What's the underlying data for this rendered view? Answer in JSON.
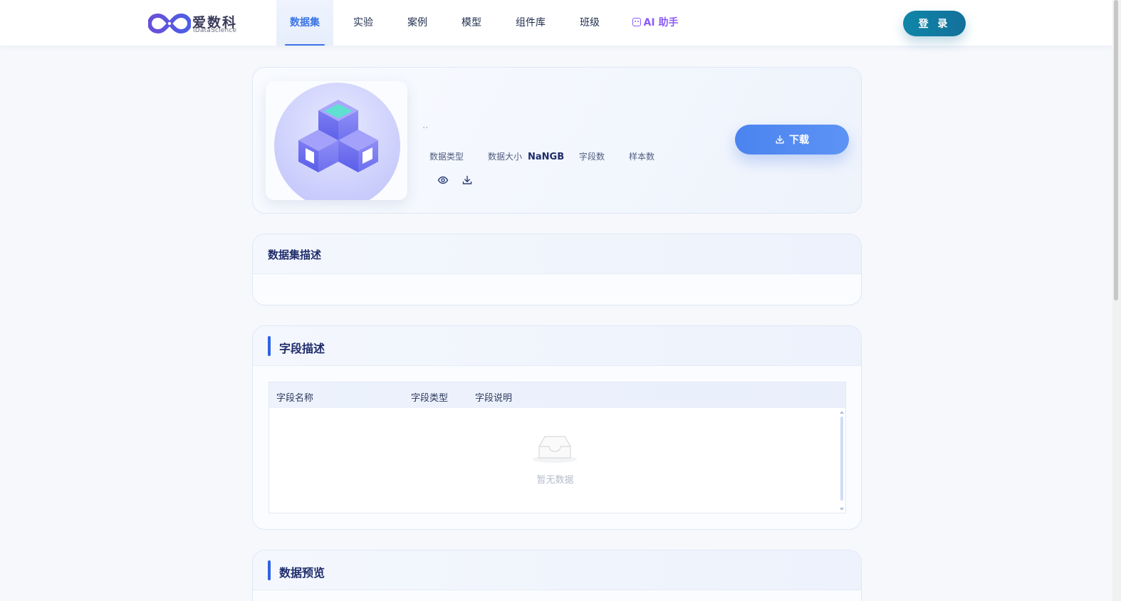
{
  "header": {
    "logo": {
      "cn": "爱数科",
      "en": "iDataScience"
    },
    "nav": [
      {
        "label": "数据集",
        "active": true
      },
      {
        "label": "实验",
        "active": false
      },
      {
        "label": "案例",
        "active": false
      },
      {
        "label": "模型",
        "active": false
      },
      {
        "label": "组件库",
        "active": false
      },
      {
        "label": "班级",
        "active": false
      },
      {
        "label": "AI 助手",
        "active": false
      }
    ],
    "login_label": "登 录"
  },
  "dataset": {
    "name": "··",
    "meta": {
      "type_label": "数据类型",
      "size_label": "数据大小",
      "size_value": "NaNGB",
      "fields_label": "字段数",
      "samples_label": "样本数"
    },
    "download_label": "下载",
    "icons": [
      "eye-icon",
      "download-icon"
    ]
  },
  "description": {
    "title": "数据集描述"
  },
  "fields": {
    "title": "字段描述",
    "columns": [
      "字段名称",
      "字段类型",
      "字段说明"
    ],
    "empty_text": "暂无数据"
  },
  "preview": {
    "title": "数据预览"
  },
  "colors": {
    "accent": "#3b74e6",
    "login": "#12809f",
    "ai": "#8b5cf6",
    "title": "#1f2d6b"
  }
}
